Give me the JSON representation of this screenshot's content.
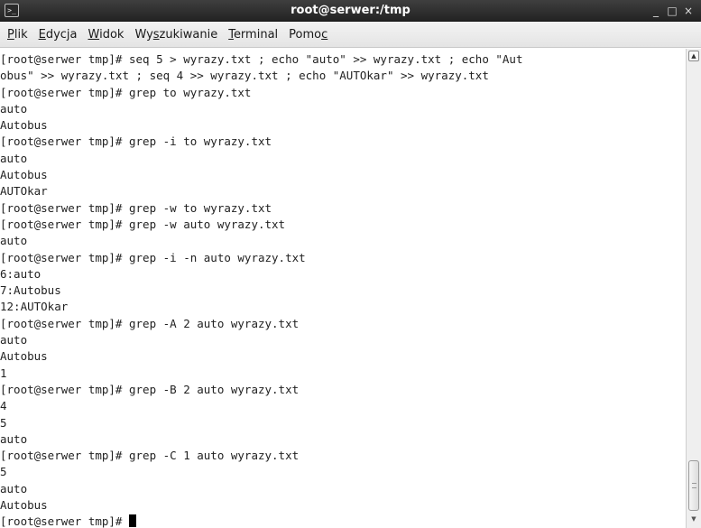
{
  "window": {
    "title": "root@serwer:/tmp",
    "icon": "terminal-icon",
    "controls": [
      "_",
      "□",
      "×"
    ]
  },
  "menu": [
    {
      "label": "Plik",
      "mnemonic": "P",
      "rest": "lik",
      "prefix": ""
    },
    {
      "label": "Edycja",
      "mnemonic": "E",
      "rest": "dycja",
      "prefix": ""
    },
    {
      "label": "Widok",
      "mnemonic": "W",
      "rest": "idok",
      "prefix": ""
    },
    {
      "label": "Wyszukiwanie",
      "prefix": "Wy",
      "mnemonic": "s",
      "rest": "zukiwanie"
    },
    {
      "label": "Terminal",
      "mnemonic": "T",
      "rest": "erminal",
      "prefix": ""
    },
    {
      "label": "Pomoc",
      "prefix": "Pomo",
      "mnemonic": "c",
      "rest": ""
    }
  ],
  "terminal_lines": [
    "[root@serwer tmp]# seq 5 > wyrazy.txt ; echo \"auto\" >> wyrazy.txt ; echo \"Aut",
    "obus\" >> wyrazy.txt ; seq 4 >> wyrazy.txt ; echo \"AUTOkar\" >> wyrazy.txt",
    "[root@serwer tmp]# grep to wyrazy.txt",
    "auto",
    "Autobus",
    "[root@serwer tmp]# grep -i to wyrazy.txt",
    "auto",
    "Autobus",
    "AUTOkar",
    "[root@serwer tmp]# grep -w to wyrazy.txt",
    "[root@serwer tmp]# grep -w auto wyrazy.txt",
    "auto",
    "[root@serwer tmp]# grep -i -n auto wyrazy.txt",
    "6:auto",
    "7:Autobus",
    "12:AUTOkar",
    "[root@serwer tmp]# grep -A 2 auto wyrazy.txt",
    "auto",
    "Autobus",
    "1",
    "[root@serwer tmp]# grep -B 2 auto wyrazy.txt",
    "4",
    "5",
    "auto",
    "[root@serwer tmp]# grep -C 1 auto wyrazy.txt",
    "5",
    "auto",
    "Autobus"
  ],
  "prompt": "[root@serwer tmp]# "
}
